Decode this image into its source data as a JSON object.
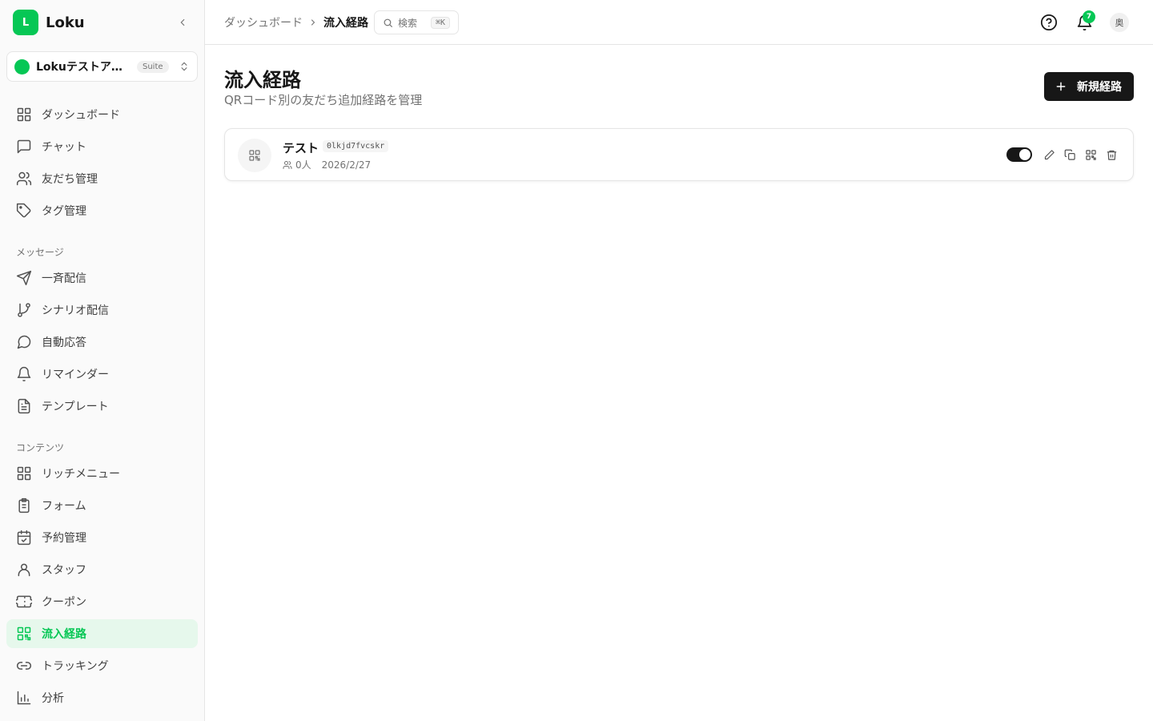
{
  "brand": {
    "logo_letter": "L",
    "name": "Loku"
  },
  "account": {
    "name": "Lokuテストアカ...",
    "badge": "Suite"
  },
  "nav": {
    "main": [
      {
        "label": "ダッシュボード",
        "icon": "layout-grid-icon"
      },
      {
        "label": "チャット",
        "icon": "message-square-icon"
      },
      {
        "label": "友だち管理",
        "icon": "users-icon"
      },
      {
        "label": "タグ管理",
        "icon": "tag-icon"
      }
    ],
    "messages_label": "メッセージ",
    "messages": [
      {
        "label": "一斉配信",
        "icon": "send-icon"
      },
      {
        "label": "シナリオ配信",
        "icon": "git-branch-icon"
      },
      {
        "label": "自動応答",
        "icon": "message-circle-icon"
      },
      {
        "label": "リマインダー",
        "icon": "bell-icon"
      },
      {
        "label": "テンプレート",
        "icon": "file-text-icon"
      }
    ],
    "contents_label": "コンテンツ",
    "contents": [
      {
        "label": "リッチメニュー",
        "icon": "layout-grid-icon"
      },
      {
        "label": "フォーム",
        "icon": "clipboard-icon"
      },
      {
        "label": "予約管理",
        "icon": "calendar-check-icon"
      },
      {
        "label": "スタッフ",
        "icon": "user-icon"
      },
      {
        "label": "クーポン",
        "icon": "ticket-icon"
      },
      {
        "label": "流入経路",
        "icon": "qr-code-icon",
        "active": true
      },
      {
        "label": "トラッキング",
        "icon": "link-icon"
      },
      {
        "label": "分析",
        "icon": "bar-chart-icon"
      }
    ]
  },
  "topbar": {
    "breadcrumb_home": "ダッシュボード",
    "breadcrumb_current": "流入経路",
    "search_label": "検索",
    "search_shortcut": "⌘K",
    "notification_count": "7",
    "avatar_initial": "奥"
  },
  "page": {
    "title": "流入経路",
    "subtitle": "QRコード別の友だち追加経路を管理",
    "new_button_label": "新規経路"
  },
  "routes": [
    {
      "name": "テスト",
      "code": "0lkjd7fvcskr",
      "friend_count": "0人",
      "date": "2026/2/27",
      "enabled": true
    }
  ],
  "colors": {
    "accent": "#06c755",
    "primary_button": "#171717",
    "active_nav_bg": "#e6f8ec"
  }
}
